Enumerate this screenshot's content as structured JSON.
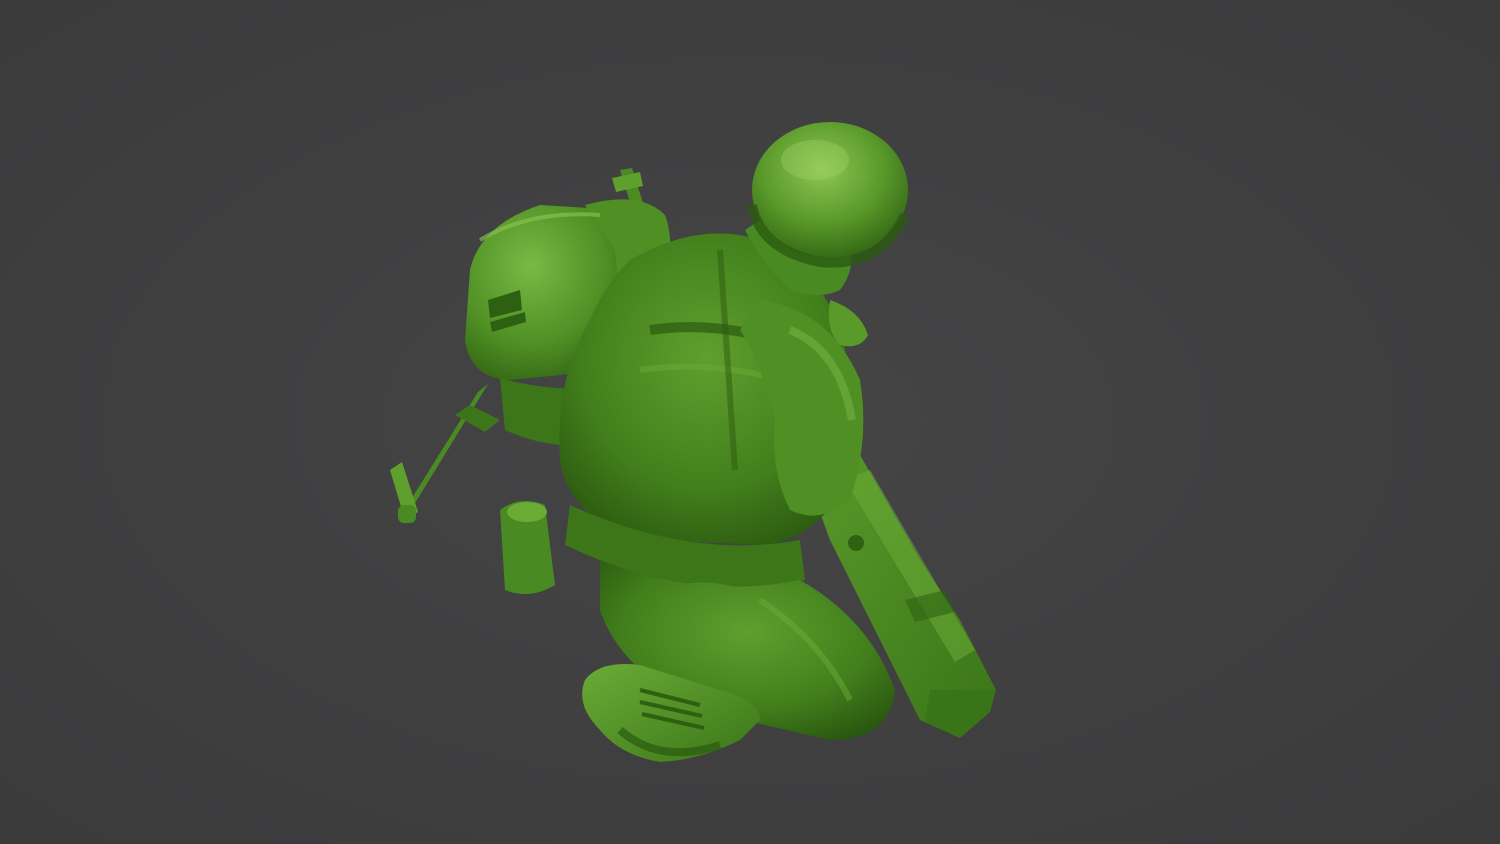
{
  "scene": {
    "subject": "toy-soldier-figure",
    "background_color": "#3f3f40",
    "model_colors": {
      "base": "#4a8a22",
      "light": "#6aab36",
      "highlight": "#8ec653",
      "shadow": "#2b5a10",
      "deep_shadow": "#1e4209"
    }
  }
}
